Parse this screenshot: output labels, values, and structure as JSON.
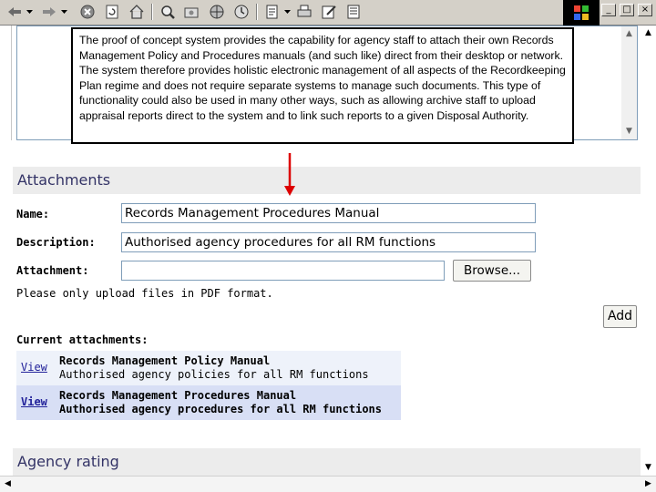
{
  "toolbar": {
    "icons": [
      "back-arrow-icon",
      "back-dropdown-icon",
      "forward-arrow-icon",
      "forward-dropdown-icon",
      "stop-icon",
      "refresh-icon",
      "home-icon",
      "search-icon",
      "favorites-icon",
      "media-icon",
      "history-icon",
      "mail-icon",
      "mail-dropdown-icon",
      "print-icon",
      "edit-icon",
      "discuss-icon"
    ],
    "window_buttons": [
      "_",
      "□",
      "×"
    ]
  },
  "callout": {
    "text": "The proof of concept system provides the capability for agency staff to attach their own Records Management Policy and Procedures manuals (and such like) direct from their desktop or network. The system therefore provides holistic electronic management of all aspects of the Recordkeeping Plan regime and does not require separate systems to manage such documents. This type of functionality could also be used in many other ways, such as allowing archive staff to upload appraisal reports direct to the system and to link such reports to a given Disposal Authority."
  },
  "attachments": {
    "header": "Attachments",
    "name_label": "Name:",
    "name_value": "Records Management Procedures Manual",
    "description_label": "Description:",
    "description_value": "Authorised agency procedures for all RM functions",
    "attachment_label": "Attachment:",
    "attachment_value": "",
    "browse_label": "Browse...",
    "hint": "Please only upload files in PDF format.",
    "add_label": "Add",
    "current_label": "Current attachments:",
    "items": [
      {
        "view": "View",
        "title": "Records Management Policy Manual",
        "desc": "Authorised agency policies for all RM functions"
      },
      {
        "view": "View",
        "title": "Records Management Procedures Manual",
        "desc": "Authorised agency procedures for all RM functions"
      }
    ]
  },
  "agency_rating": {
    "header": "Agency rating"
  },
  "colors": {
    "accent": "#333366",
    "link": "#22229a",
    "row_alt": "#d8dff5",
    "row": "#eef2fa",
    "annotation_arrow": "#dd0000"
  }
}
